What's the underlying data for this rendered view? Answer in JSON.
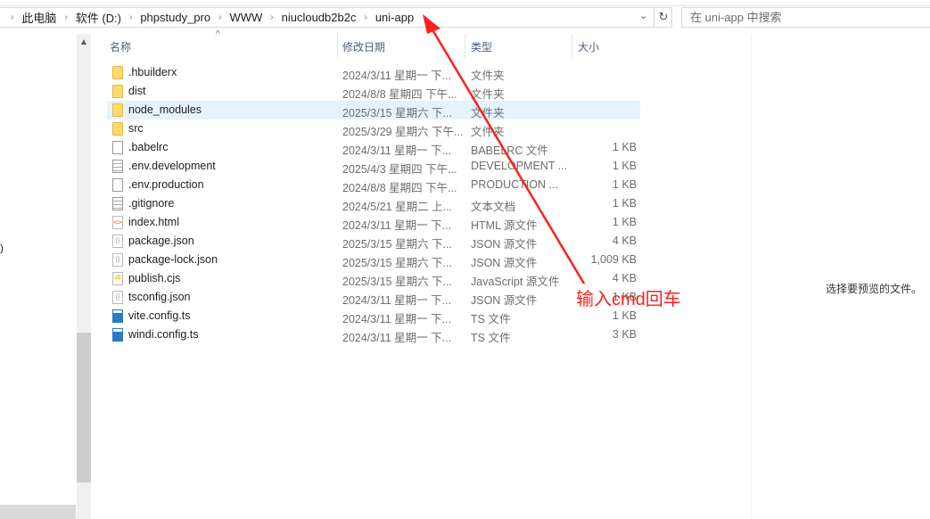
{
  "breadcrumb": [
    "此电脑",
    "软件 (D:)",
    "phpstudy_pro",
    "WWW",
    "niucloudb2b2c",
    "uni-app"
  ],
  "search": {
    "placeholder": "在 uni-app 中搜索"
  },
  "nav": {
    "partial_text": ")"
  },
  "columns": {
    "name": "名称",
    "date": "修改日期",
    "type": "类型",
    "size": "大小"
  },
  "files": [
    {
      "name": ".hbuilderx",
      "date": "2024/3/11 星期一 下...",
      "type": "文件夹",
      "size": "",
      "icon": "folder"
    },
    {
      "name": "dist",
      "date": "2024/8/8 星期四 下午...",
      "type": "文件夹",
      "size": "",
      "icon": "folder"
    },
    {
      "name": "node_modules",
      "date": "2025/3/15 星期六 下...",
      "type": "文件夹",
      "size": "",
      "icon": "folder",
      "selected": true
    },
    {
      "name": "src",
      "date": "2025/3/29 星期六 下午...",
      "type": "文件夹",
      "size": "",
      "icon": "folder"
    },
    {
      "name": ".babelrc",
      "date": "2024/3/11 星期一 下...",
      "type": "BABELRC 文件",
      "size": "1 KB",
      "icon": "file"
    },
    {
      "name": ".env.development",
      "date": "2025/4/3 星期四 下午...",
      "type": "DEVELOPMENT ...",
      "size": "1 KB",
      "icon": "txt"
    },
    {
      "name": ".env.production",
      "date": "2024/8/8 星期四 下午...",
      "type": "PRODUCTION ...",
      "size": "1 KB",
      "icon": "file"
    },
    {
      "name": ".gitignore",
      "date": "2024/5/21 星期二 上...",
      "type": "文本文档",
      "size": "1 KB",
      "icon": "txt"
    },
    {
      "name": "index.html",
      "date": "2024/3/11 星期一 下...",
      "type": "HTML 源文件",
      "size": "1 KB",
      "icon": "html"
    },
    {
      "name": "package.json",
      "date": "2025/3/15 星期六 下...",
      "type": "JSON 源文件",
      "size": "4 KB",
      "icon": "json"
    },
    {
      "name": "package-lock.json",
      "date": "2025/3/15 星期六 下...",
      "type": "JSON 源文件",
      "size": "1,009 KB",
      "icon": "json"
    },
    {
      "name": "publish.cjs",
      "date": "2025/3/15 星期六 下...",
      "type": "JavaScript 源文件",
      "size": "4 KB",
      "icon": "js"
    },
    {
      "name": "tsconfig.json",
      "date": "2024/3/11 星期一 下...",
      "type": "JSON 源文件",
      "size": "1 KB",
      "icon": "json"
    },
    {
      "name": "vite.config.ts",
      "date": "2024/3/11 星期一 下...",
      "type": "TS 文件",
      "size": "1 KB",
      "icon": "ts"
    },
    {
      "name": "windi.config.ts",
      "date": "2024/3/11 星期一 下...",
      "type": "TS 文件",
      "size": "3 KB",
      "icon": "ts"
    }
  ],
  "preview": {
    "empty_text": "选择要预览的文件。"
  },
  "annotation": {
    "text": "输入cmd回车",
    "color": "#ff1f1f"
  }
}
